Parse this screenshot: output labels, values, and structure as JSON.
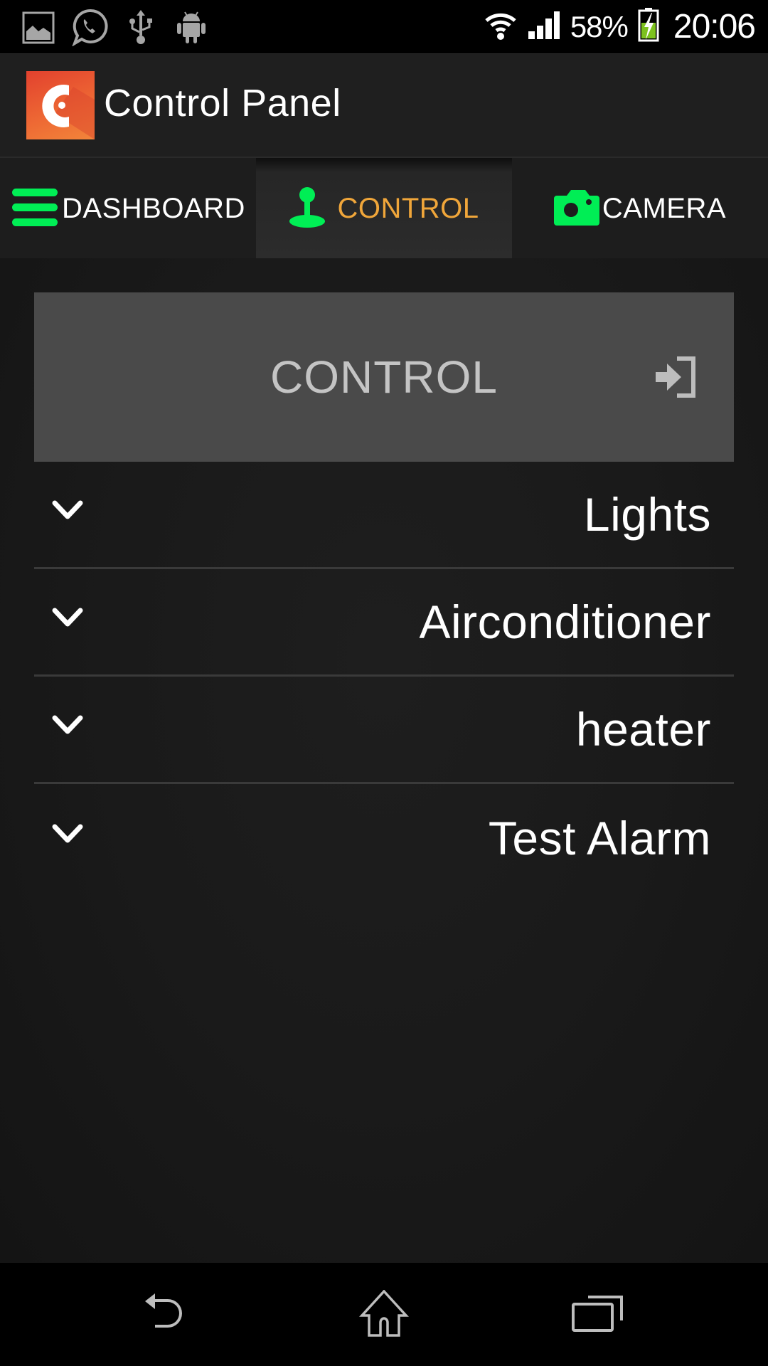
{
  "status_bar": {
    "left_icons": [
      "gallery-icon",
      "whatsapp-icon",
      "usb-icon",
      "android-icon"
    ],
    "wifi": "wifi-icon",
    "signal": "signal-icon",
    "battery_percent": "58%",
    "battery_state": "charging",
    "time": "20:06"
  },
  "app_bar": {
    "title": "Control Panel",
    "logo": "app-logo-icon"
  },
  "tabs": [
    {
      "label": "DASHBOARD",
      "icon": "menu-icon",
      "selected": false
    },
    {
      "label": "CONTROL",
      "icon": "joystick-icon",
      "selected": true
    },
    {
      "label": "CAMERA",
      "icon": "camera-icon",
      "selected": false
    }
  ],
  "colors": {
    "accent_green": "#00ee55",
    "selected_tab_text": "#f0a63a",
    "logo_orange": "#ee6a34",
    "header_gray": "#4a4a4a"
  },
  "control_section": {
    "header_label": "CONTROL",
    "header_icon": "login-icon",
    "items": [
      {
        "label": "Lights"
      },
      {
        "label": "Airconditioner"
      },
      {
        "label": "heater"
      },
      {
        "label": "Test Alarm"
      }
    ]
  },
  "nav_bar": {
    "buttons": [
      "back",
      "home",
      "recents"
    ]
  }
}
